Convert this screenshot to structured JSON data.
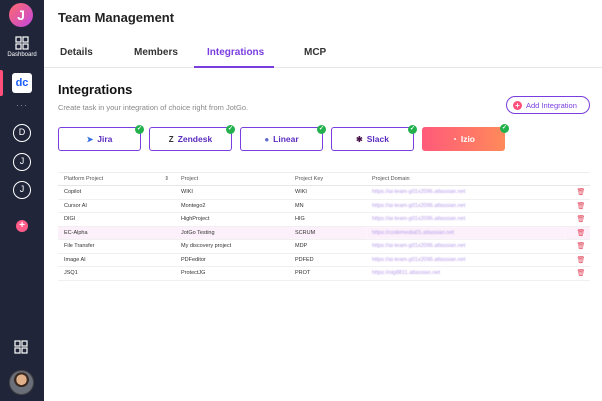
{
  "app": {
    "logo_letter": "J"
  },
  "sidebar": {
    "dashboard_label": "Dashboard",
    "workspace_tile": "dc",
    "more_dots": "···",
    "workspaces": [
      "D",
      "J",
      "J"
    ],
    "add_label": "+"
  },
  "header": {
    "title": "Team Management"
  },
  "tabs": [
    {
      "label": "Details"
    },
    {
      "label": "Members"
    },
    {
      "label": "Integrations",
      "active": true
    },
    {
      "label": "MCP"
    }
  ],
  "integrations": {
    "title": "Integrations",
    "subtitle": "Create task in your integration of choice right from JotGo.",
    "add_button": "Add Integration",
    "cards": [
      {
        "name": "Jira",
        "icon": "jira-icon"
      },
      {
        "name": "Zendesk",
        "icon": "zendesk-icon"
      },
      {
        "name": "Linear",
        "icon": "linear-icon"
      },
      {
        "name": "Slack",
        "icon": "slack-icon"
      },
      {
        "name": "Izio",
        "icon": "izio-icon"
      }
    ]
  },
  "table": {
    "headers": [
      "Platform Project",
      "Project",
      "Project Key",
      "Project Domain"
    ],
    "rows": [
      [
        "Copilot",
        "WIKI",
        "WIKI",
        "https://ai-team-g01x2096.atlassian.net"
      ],
      [
        "Cursor AI",
        "Montego2",
        "MN",
        "https://ai-team-g01x2096.atlassian.net"
      ],
      [
        "DIGI",
        "HighProject",
        "HIG",
        "https://ai-team-g01x2096.atlassian.net"
      ],
      [
        "EC-Alpha",
        "JotGo Testing",
        "SCRUM",
        "https://codemedia01.atlassian.net"
      ],
      [
        "File Transfer",
        "My discovery project",
        "MDP",
        "https://ai-team-g01x2096.atlassian.net"
      ],
      [
        "Image AI",
        "PDFeditor",
        "PDFED",
        "https://ai-team-g01x2096.atlassian.net"
      ],
      [
        "JSQ1",
        "ProtectJG",
        "PROT",
        "https://olg8811.atlassian.net"
      ]
    ]
  },
  "colors": {
    "accent": "#7a3ee0",
    "sidebar": "#20253a",
    "success": "#22b14c",
    "danger": "#e2455a"
  }
}
